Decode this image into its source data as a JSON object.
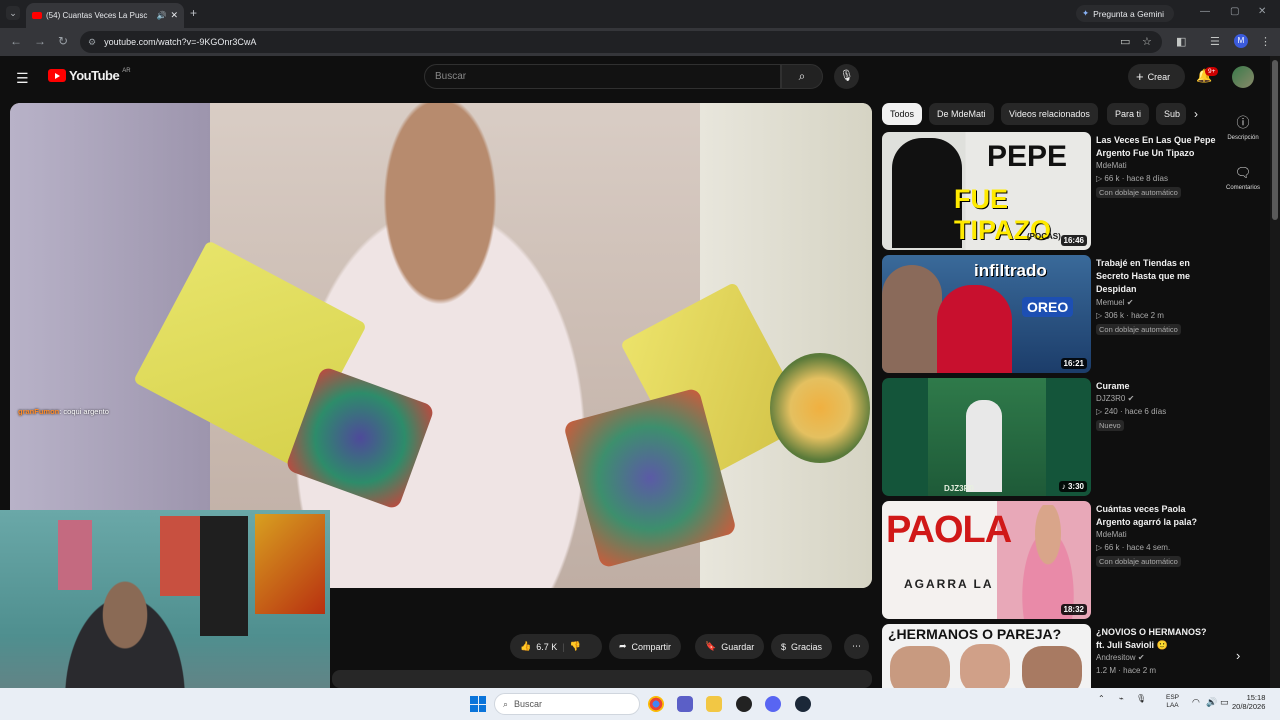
{
  "browser": {
    "tab_title": "(54) Cuantas Veces La Pusc",
    "new_tab": "+",
    "gemini_label": "Pregunta a Gemini",
    "url": "youtube.com/watch?v=-9KGOnr3CwA",
    "profile_initial": "M"
  },
  "youtube": {
    "logo_text": "YouTube",
    "country_code": "AR",
    "search_placeholder": "Buscar",
    "create_label": "Crear",
    "notif_badge": "9+"
  },
  "player": {
    "chat_user": "granFumon",
    "chat_text": ": coqui argento"
  },
  "actions": {
    "likes": "6.7 K",
    "share": "Compartir",
    "save": "Guardar",
    "thanks": "Gracias"
  },
  "chips": [
    "Todos",
    "De MdeMati",
    "Videos relacionados",
    "Para ti",
    "Sub"
  ],
  "side_panel": {
    "description": "Descripción",
    "comments": "Comentarios"
  },
  "recommendations": [
    {
      "title": "Las Veces En Las Que Pepe Argento Fue Un Tipazo",
      "channel": "MdeMati",
      "views": "66 k",
      "age": "hace 8 días",
      "tag": "Con doblaje automático",
      "duration": "16:46",
      "thumb_text_1": "PEPE",
      "thumb_text_2": "FUE TIPAZO",
      "thumb_text_3": "(POCAS)"
    },
    {
      "title": "Trabajé en Tiendas en Secreto Hasta que me Despidan",
      "channel": "Memuel",
      "views": "306 k",
      "age": "hace 2 m",
      "tag": "Con doblaje automático",
      "duration": "16:21",
      "thumb_text_1": "infiltrado",
      "thumb_text_2": "OREO"
    },
    {
      "title": "Curame",
      "channel": "DJZ3R0",
      "views": "240",
      "age": "hace 6 días",
      "tag": "Nuevo",
      "duration": "3:30",
      "thumb_text_1": "DJZ3R0"
    },
    {
      "title": "Cuántas veces Paola Argento agarró la pala?",
      "channel": "MdeMati",
      "views": "66 k",
      "age": "hace 4 sem.",
      "tag": "Con doblaje automático",
      "duration": "18:32",
      "thumb_text_1": "PAOLA",
      "thumb_text_2": "AGARRA LA"
    },
    {
      "title": "¿NOVIOS O HERMANOS? ft. Juli Savioli 🙂",
      "channel": "Andresitow",
      "views": "1.2 M",
      "age": "hace 2 m",
      "thumb_text_1": "¿HERMANOS O PAREJA?"
    }
  ],
  "taskbar": {
    "search": "Buscar",
    "lang_1": "ESP",
    "lang_2": "LAA",
    "time": "15:18",
    "date": "20/8/2026"
  }
}
